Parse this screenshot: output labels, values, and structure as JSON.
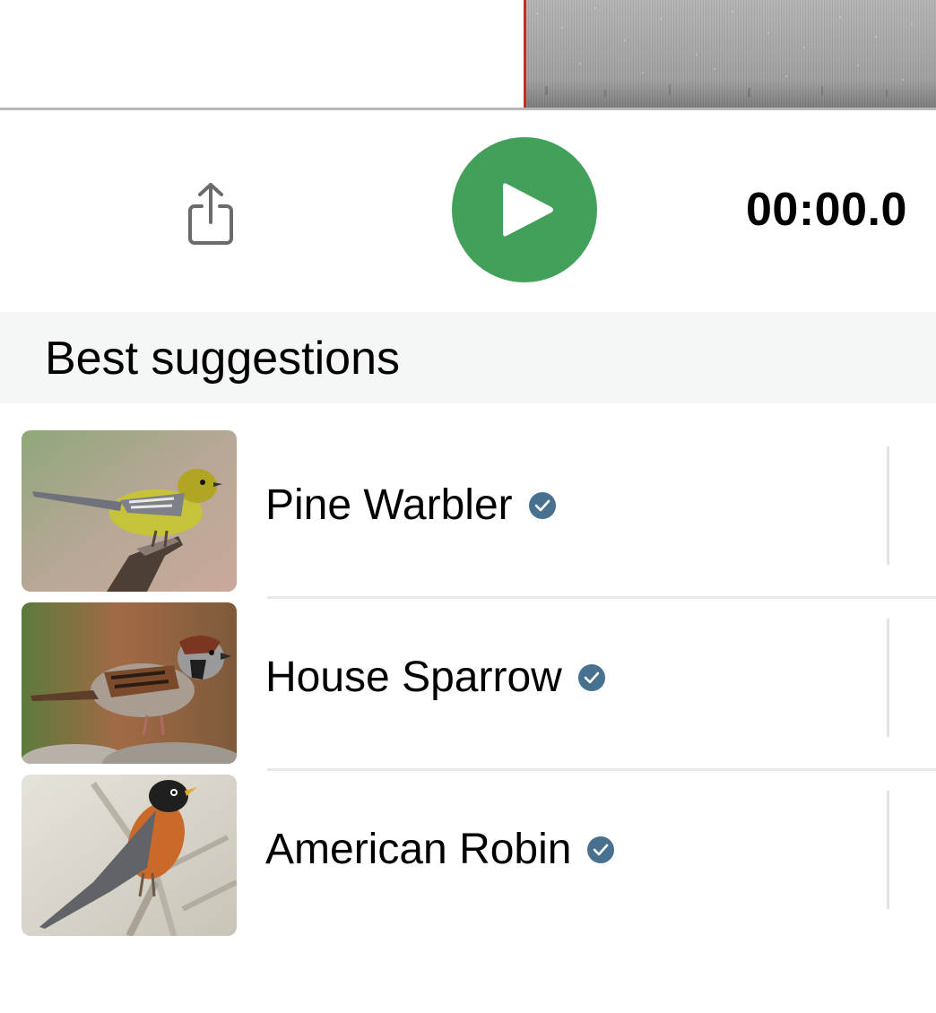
{
  "player": {
    "timer": "00:00.0",
    "share_icon": "share-icon",
    "play_icon": "play-icon",
    "accent_color": "#43a05a",
    "playhead_color": "#c62a2a"
  },
  "suggestions": {
    "title": "Best suggestions",
    "verified_color": "#47718f",
    "items": [
      {
        "name": "Pine Warbler",
        "verified_icon": "verified-check-icon"
      },
      {
        "name": "House Sparrow",
        "verified_icon": "verified-check-icon"
      },
      {
        "name": "American Robin",
        "verified_icon": "verified-check-icon"
      }
    ]
  }
}
